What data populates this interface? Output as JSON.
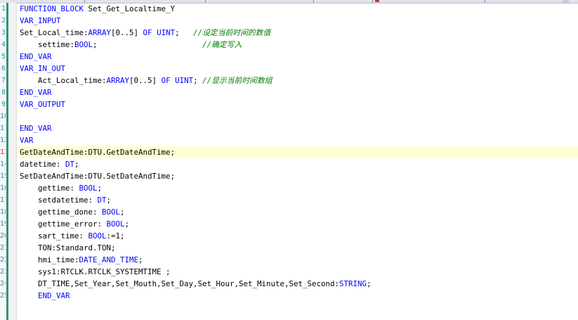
{
  "editor": {
    "line_numbers": [
      "1",
      "2",
      "3",
      "4",
      "5",
      "6",
      "7",
      "8",
      "9",
      "10",
      "11",
      "12",
      "13",
      "14",
      "15",
      "16",
      "17",
      "18",
      "19",
      "20",
      "21",
      "22",
      "23",
      "24",
      "25"
    ],
    "current_line": 13,
    "lines": [
      {
        "indent": 0,
        "tokens": [
          {
            "t": "kw",
            "v": "FUNCTION_BLOCK"
          },
          {
            "t": "tx",
            "v": " Set_Get_Localtime_Y"
          }
        ]
      },
      {
        "indent": 0,
        "tokens": [
          {
            "t": "kw",
            "v": "VAR_INPUT"
          }
        ]
      },
      {
        "indent": 0,
        "tokens": [
          {
            "t": "tx",
            "v": "Set_Local_time:"
          },
          {
            "t": "kw",
            "v": "ARRAY"
          },
          {
            "t": "tx",
            "v": "[0..5] "
          },
          {
            "t": "kw",
            "v": "OF"
          },
          {
            "t": "tx",
            "v": " "
          },
          {
            "t": "kw",
            "v": "UINT"
          },
          {
            "t": "tx",
            "v": ";   "
          },
          {
            "t": "cm",
            "v": "//设定当前时间的数值"
          }
        ]
      },
      {
        "indent": 1,
        "tokens": [
          {
            "t": "tx",
            "v": "settime:"
          },
          {
            "t": "kw",
            "v": "BOOL"
          },
          {
            "t": "tx",
            "v": ";                       "
          },
          {
            "t": "cm",
            "v": "//确定写入"
          }
        ]
      },
      {
        "indent": 0,
        "tokens": [
          {
            "t": "kw",
            "v": "END_VAR"
          }
        ]
      },
      {
        "indent": 0,
        "tokens": [
          {
            "t": "kw",
            "v": "VAR_IN_OUT"
          }
        ]
      },
      {
        "indent": 1,
        "tokens": [
          {
            "t": "tx",
            "v": "Act_Local_time:"
          },
          {
            "t": "kw",
            "v": "ARRAY"
          },
          {
            "t": "tx",
            "v": "[0..5] "
          },
          {
            "t": "kw",
            "v": "OF"
          },
          {
            "t": "tx",
            "v": " "
          },
          {
            "t": "kw",
            "v": "UINT"
          },
          {
            "t": "tx",
            "v": "; "
          },
          {
            "t": "cm",
            "v": "//显示当前时间数组"
          }
        ]
      },
      {
        "indent": 0,
        "tokens": [
          {
            "t": "kw",
            "v": "END_VAR"
          }
        ]
      },
      {
        "indent": 0,
        "tokens": [
          {
            "t": "kw",
            "v": "VAR_OUTPUT"
          }
        ]
      },
      {
        "indent": 0,
        "tokens": []
      },
      {
        "indent": 0,
        "tokens": [
          {
            "t": "kw",
            "v": "END_VAR"
          }
        ]
      },
      {
        "indent": 0,
        "tokens": [
          {
            "t": "kw",
            "v": "VAR"
          }
        ]
      },
      {
        "indent": 0,
        "tokens": [
          {
            "t": "tx",
            "v": "GetDateAndTime:DTU.GetDateAndTime;"
          }
        ]
      },
      {
        "indent": 0,
        "tokens": [
          {
            "t": "tx",
            "v": "datetime: "
          },
          {
            "t": "kw",
            "v": "DT"
          },
          {
            "t": "tx",
            "v": ";"
          }
        ]
      },
      {
        "indent": 0,
        "tokens": [
          {
            "t": "tx",
            "v": "SetDateAndTime:DTU.SetDateAndTime;"
          }
        ]
      },
      {
        "indent": 1,
        "tokens": [
          {
            "t": "tx",
            "v": "gettime: "
          },
          {
            "t": "kw",
            "v": "BOOL"
          },
          {
            "t": "tx",
            "v": ";"
          }
        ]
      },
      {
        "indent": 1,
        "tokens": [
          {
            "t": "tx",
            "v": "setdatetime: "
          },
          {
            "t": "kw",
            "v": "DT"
          },
          {
            "t": "tx",
            "v": ";"
          }
        ]
      },
      {
        "indent": 1,
        "tokens": [
          {
            "t": "tx",
            "v": "gettime_done: "
          },
          {
            "t": "kw",
            "v": "BOOL"
          },
          {
            "t": "tx",
            "v": ";"
          }
        ]
      },
      {
        "indent": 1,
        "tokens": [
          {
            "t": "tx",
            "v": "gettime_error: "
          },
          {
            "t": "kw",
            "v": "BOOL"
          },
          {
            "t": "tx",
            "v": ";"
          }
        ]
      },
      {
        "indent": 1,
        "tokens": [
          {
            "t": "tx",
            "v": "sart_time: "
          },
          {
            "t": "kw",
            "v": "BOOL"
          },
          {
            "t": "tx",
            "v": ":=1;"
          }
        ]
      },
      {
        "indent": 1,
        "tokens": [
          {
            "t": "tx",
            "v": "TON:Standard.TON;"
          }
        ]
      },
      {
        "indent": 1,
        "tokens": [
          {
            "t": "tx",
            "v": "hmi_time:"
          },
          {
            "t": "kw",
            "v": "DATE_AND_TIME"
          },
          {
            "t": "tx",
            "v": ";"
          }
        ]
      },
      {
        "indent": 1,
        "tokens": [
          {
            "t": "tx",
            "v": "sys1:RTCLK.RTCLK_SYSTEMTIME ;"
          }
        ]
      },
      {
        "indent": 1,
        "tokens": [
          {
            "t": "tx",
            "v": "DT_TIME,Set_Year,Set_Mouth,Set_Day,Set_Hour,Set_Minute,Set_Second:"
          },
          {
            "t": "kw",
            "v": "STRING"
          },
          {
            "t": "tx",
            "v": ";"
          }
        ]
      },
      {
        "indent": 1,
        "tokens": [
          {
            "t": "kw",
            "v": "END_VAR"
          }
        ]
      }
    ],
    "colors": {
      "keyword": "#0000ff",
      "comment": "#008000",
      "text": "#000000",
      "line_number": "#2b91af",
      "current_line_bg": "#ffffd2",
      "fold_bar": "#2f8f7a"
    }
  }
}
